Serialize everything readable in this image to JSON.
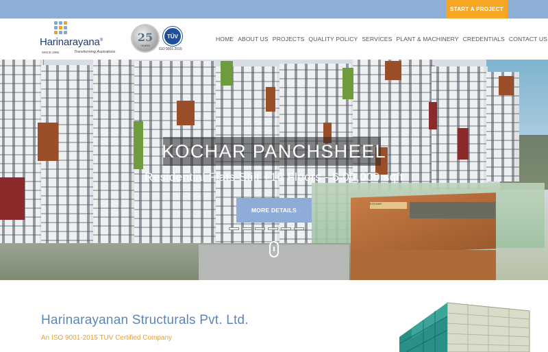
{
  "topbar": {
    "cta_label": "START A PROJECT"
  },
  "brand": {
    "name": "Harinarayana",
    "since": "SINCE 1995",
    "tagline": "Transforming Aspirations",
    "anniversary_number": "25",
    "anniversary_word": "YEARS",
    "cert_logo": "TÜV",
    "cert_caption": "ISO 9001:2015"
  },
  "nav": {
    "items": [
      {
        "label": "HOME"
      },
      {
        "label": "ABOUT US"
      },
      {
        "label": "PROJECTS"
      },
      {
        "label": "QUALITY POLICY"
      },
      {
        "label": "SERVICES"
      },
      {
        "label": "PLANT & MACHINERY"
      },
      {
        "label": "CREDENTIALS"
      },
      {
        "label": "CONTACT US"
      }
    ]
  },
  "hero": {
    "title": "KOCHAR PANCHSHEEL",
    "subtitle": "Residential Flats Stilt +16 Floors - 6,00,000 sqft",
    "button_label": "MORE DETAILS",
    "slides_total": 6,
    "active_slide": 1,
    "sign_text": "KOCHAR"
  },
  "company": {
    "name": "Harinarayanan Structurals Pvt. Ltd.",
    "tagline": "An ISO 9001-2015 TUV Certified Company"
  },
  "colors": {
    "topbar": "#8faed6",
    "cta": "#f5a623",
    "accent_blue": "#5a86b8",
    "accent_orange": "#e8a02a"
  }
}
